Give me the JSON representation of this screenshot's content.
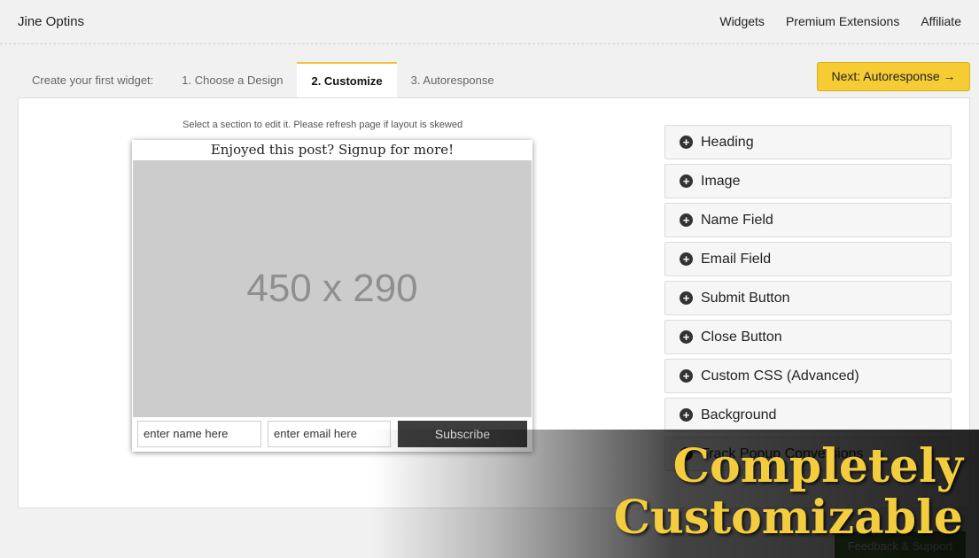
{
  "app": {
    "brand": "Jine Optins",
    "nav": [
      "Widgets",
      "Premium Extensions",
      "Affiliate"
    ]
  },
  "wizard": {
    "lead": "Create your first widget:",
    "tabs": [
      "1. Choose a Design",
      "2. Customize",
      "3. Autoresponse"
    ],
    "active_tab": "2. Customize",
    "next_label": "Next: Autoresponse →"
  },
  "editor": {
    "hint": "Select a section to edit it. Please refresh page if layout is skewed"
  },
  "widget": {
    "heading": "Enjoyed this post? Signup for more!",
    "image_label": "450 x 290",
    "name_value": "enter name here",
    "email_value": "enter email here",
    "submit_label": "Subscribe"
  },
  "sections": [
    "Heading",
    "Image",
    "Name Field",
    "Email Field",
    "Submit Button",
    "Close Button",
    "Custom CSS (Advanced)",
    "Background",
    "Track Popup Conversions"
  ],
  "feedback_label": "Feedback & Support",
  "promo": {
    "line1": "Completely",
    "line2": "Customizable"
  },
  "colors": {
    "accent": "#f6cc35",
    "submit_bg": "#3d3d3d",
    "promo_text": "#f3cd3e"
  }
}
